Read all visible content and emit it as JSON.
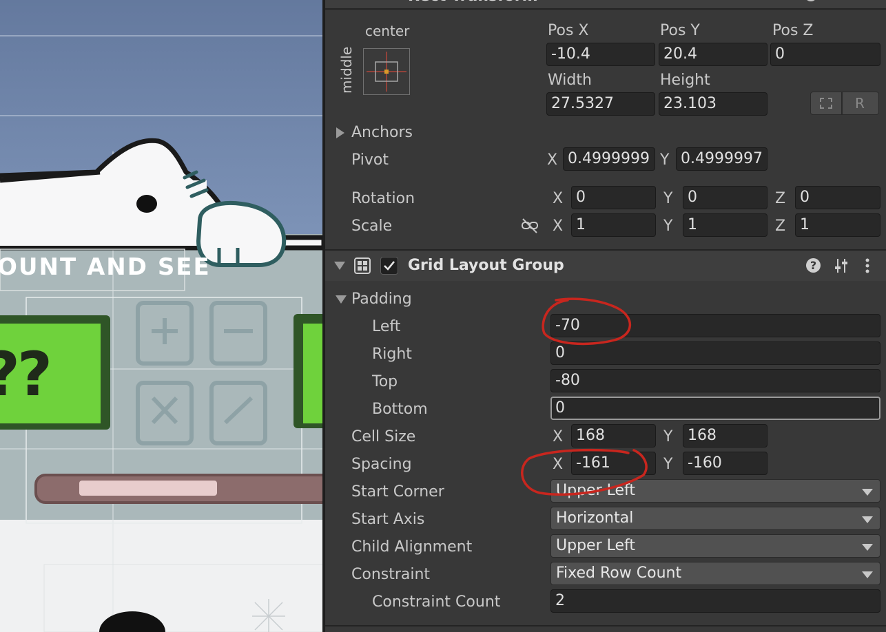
{
  "scene": {
    "banner_text": "OUNT AND SEE",
    "question_marks": "??"
  },
  "rect_transform": {
    "header_title": "Rect Transform",
    "anchor_preset": {
      "horizontal": "center",
      "vertical": "middle"
    },
    "pos_x": {
      "label": "Pos X",
      "value": "-10.4"
    },
    "pos_y": {
      "label": "Pos Y",
      "value": "20.4"
    },
    "pos_z": {
      "label": "Pos Z",
      "value": "0"
    },
    "width": {
      "label": "Width",
      "value": "27.5327"
    },
    "height": {
      "label": "Height",
      "value": "23.103"
    },
    "raw_edit_label": "R",
    "anchors_label": "Anchors",
    "pivot": {
      "label": "Pivot",
      "x": "0.4999999",
      "y": "0.4999997"
    },
    "rotation": {
      "label": "Rotation",
      "x": "0",
      "y": "0",
      "z": "0"
    },
    "scale": {
      "label": "Scale",
      "x": "1",
      "y": "1",
      "z": "1"
    },
    "axis_labels": {
      "x": "X",
      "y": "Y",
      "z": "Z"
    }
  },
  "grid_layout_group": {
    "title": "Grid Layout Group",
    "enabled": true,
    "padding": {
      "label": "Padding",
      "left": {
        "label": "Left",
        "value": "-70"
      },
      "right": {
        "label": "Right",
        "value": "0"
      },
      "top": {
        "label": "Top",
        "value": "-80"
      },
      "bottom": {
        "label": "Bottom",
        "value": "0"
      }
    },
    "cell_size": {
      "label": "Cell Size",
      "x": "168",
      "y": "168"
    },
    "spacing": {
      "label": "Spacing",
      "x": "-161",
      "y": "-160"
    },
    "start_corner": {
      "label": "Start Corner",
      "value": "Upper Left"
    },
    "start_axis": {
      "label": "Start Axis",
      "value": "Horizontal"
    },
    "child_alignment": {
      "label": "Child Alignment",
      "value": "Upper Left"
    },
    "constraint": {
      "label": "Constraint",
      "value": "Fixed Row Count"
    },
    "constraint_count": {
      "label": "Constraint Count",
      "value": "2"
    }
  },
  "colors": {
    "annotation_red": "#c8261e",
    "scene_sky": "#6a7fa3",
    "scene_green": "#6fd23c",
    "inspector_bg": "#383838"
  },
  "icons": [
    "help-icon",
    "presets-icon",
    "more-icon",
    "grid-layout-icon",
    "unlink-scale-icon",
    "blueprint-icon",
    "foldout-icon"
  ]
}
